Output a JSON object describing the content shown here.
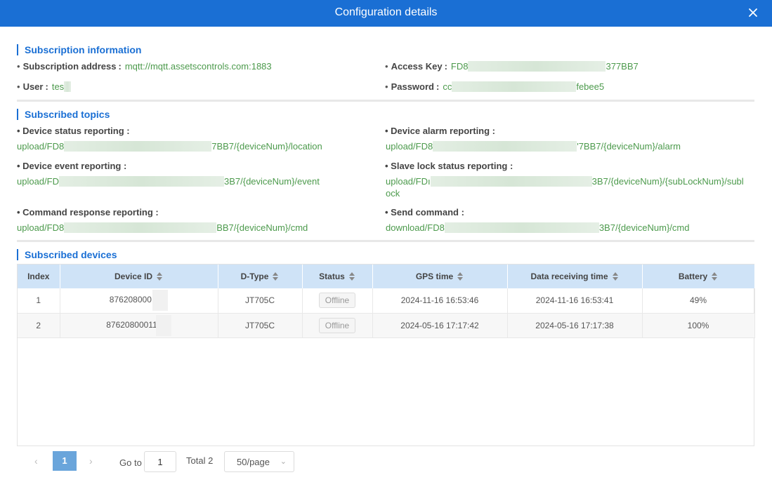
{
  "dialog": {
    "title": "Configuration details"
  },
  "subscription": {
    "heading": "Subscription information",
    "address_label": "Subscription address",
    "address_value": "mqtt://mqtt.assetscontrols.com:1883",
    "access_key_label": "Access Key",
    "access_key_prefix": "FD8",
    "access_key_suffix": "377BB7",
    "user_label": "User",
    "user_value": "tes",
    "password_label": "Password",
    "password_prefix": "cc",
    "password_suffix": "febee5",
    "colon": ":"
  },
  "topics": {
    "heading": "Subscribed topics",
    "status_label": "Device status reporting :",
    "status_prefix": "upload/FD8",
    "status_suffix": "7BB7/{deviceNum}/location",
    "alarm_label": "Device alarm reporting :",
    "alarm_prefix": "upload/FD8",
    "alarm_suffix": "'7BB7/{deviceNum}/alarm",
    "event_label": "Device event reporting :",
    "event_prefix": "upload/FD",
    "event_suffix": "3B7/{deviceNum}/event",
    "slave_label": "Slave lock status reporting :",
    "slave_prefix": "upload/FDı",
    "slave_suffix": "3B7/{deviceNum}/{subLockNum}/subl",
    "slave_suffix2": "ock",
    "cmdresp_label": "Command response reporting :",
    "cmdresp_prefix": "upload/FD8",
    "cmdresp_suffix": "BB7/{deviceNum}/cmd",
    "send_label": "Send command :",
    "send_prefix": "download/FD8",
    "send_suffix": "3B7/{deviceNum}/cmd"
  },
  "devices": {
    "heading": "Subscribed devices",
    "columns": [
      "Index",
      "Device ID",
      "D-Type",
      "Status",
      "GPS time",
      "Data receiving time",
      "Battery"
    ],
    "rows": [
      {
        "index": "1",
        "device_id": "876208000ı",
        "dtype": "JT705C",
        "status": "Offline",
        "gps_time": "2024-11-16 16:53:46",
        "data_time": "2024-11-16 16:53:41",
        "battery": "49%"
      },
      {
        "index": "2",
        "device_id": "87620800011",
        "dtype": "JT705C",
        "status": "Offline",
        "gps_time": "2024-05-16 17:17:42",
        "data_time": "2024-05-16 17:17:38",
        "battery": "100%"
      }
    ]
  },
  "pagination": {
    "prev": "‹",
    "next": "›",
    "current_page": "1",
    "goto_label": "Go to",
    "goto_value": "1",
    "total_label": "Total 2",
    "page_size": "50/page"
  },
  "colors": {
    "header": "#1a6fd4",
    "accent": "#1a6fd4",
    "link_green": "#4c9a4c",
    "table_header": "#cfe3f7",
    "active_page": "#6aa5db"
  },
  "icons": {
    "close": "close-icon",
    "sort": "sort-icon",
    "dropdown": "chevron-down-icon"
  }
}
